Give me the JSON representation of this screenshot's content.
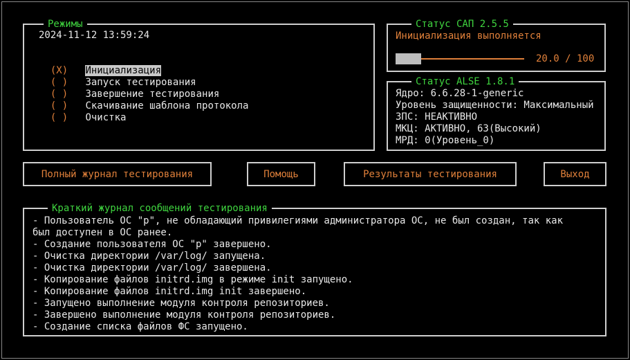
{
  "modes": {
    "title": "Режимы",
    "datetime": "2024-11-12 13:59:24",
    "items": [
      {
        "marker": "(X)",
        "label": "Инициализация",
        "selected": true
      },
      {
        "marker": "( )",
        "label": "Запуск тестирования",
        "selected": false
      },
      {
        "marker": "( )",
        "label": "Завершение тестирования",
        "selected": false
      },
      {
        "marker": "( )",
        "label": "Скачивание шаблона протокола",
        "selected": false
      },
      {
        "marker": "( )",
        "label": "Очистка",
        "selected": false
      }
    ]
  },
  "sap_status": {
    "title": "Статус САП 2.5.5",
    "state": "Инициализация выполняется",
    "progress_text": "20.0 / 100",
    "progress_fraction": 0.2
  },
  "alse_status": {
    "title": "Статус ALSE 1.8.1",
    "lines": [
      "Ядро: 6.6.28-1-generic",
      "Уровень защищенности: Максимальный",
      "ЗПС: НЕАКТИВНО",
      "МКЦ: АКТИВНО, 63(Высокий)",
      "МРД: 0(Уровень_0)"
    ]
  },
  "buttons": {
    "full_log": "Полный журнал тестирования",
    "help": "Помощь",
    "results": "Результаты тестирования",
    "exit": "Выход"
  },
  "log": {
    "title": "Краткий журнал сообщений тестирования",
    "lines": [
      "- Пользователь ОС \"p\", не обладающий привилегиями администратора ОС, не был создан, так как",
      "был доступен в ОС ранее.",
      "- Создание пользователя ОС \"p\" завершено.",
      "- Очистка директории /var/log/ запущена.",
      "- Очистка директории /var/log/ завершена.",
      "- Копирование файлов initrd.img в режиме init запущено.",
      "- Копирование файлов initrd.img init завершено.",
      "- Запущено выполнение модуля контроля репозиториев.",
      "- Завершено выполнение модуля контроля репозиториев.",
      "- Создание списка файлов ФС запущено."
    ]
  },
  "colors": {
    "title_green": "#3fd43f",
    "accent_orange": "#e0803a",
    "background": "#000000",
    "border": "#cfcfcf"
  }
}
